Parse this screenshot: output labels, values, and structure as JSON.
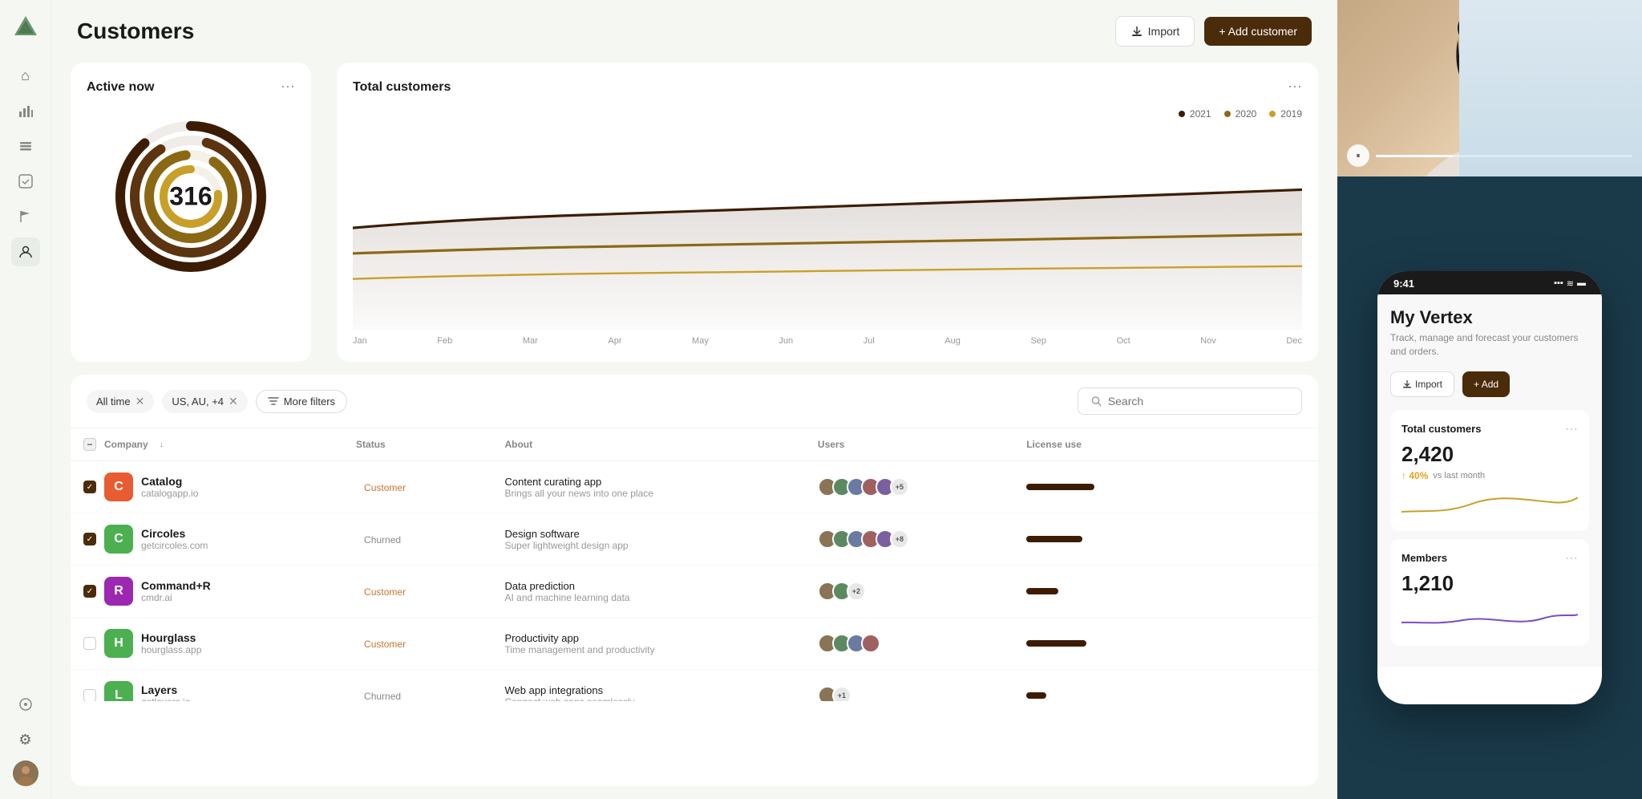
{
  "page": {
    "title": "Customers"
  },
  "header": {
    "import_label": "Import",
    "add_customer_label": "+ Add customer"
  },
  "sidebar": {
    "logo": "▲",
    "items": [
      {
        "icon": "⌂",
        "name": "home",
        "active": false
      },
      {
        "icon": "📊",
        "name": "analytics",
        "active": false
      },
      {
        "icon": "⊞",
        "name": "layers",
        "active": false
      },
      {
        "icon": "✓",
        "name": "tasks",
        "active": false
      },
      {
        "icon": "⚑",
        "name": "flags",
        "active": false
      },
      {
        "icon": "👥",
        "name": "customers",
        "active": true
      }
    ],
    "bottom_items": [
      {
        "icon": "⊙",
        "name": "profile"
      },
      {
        "icon": "⚙",
        "name": "settings"
      }
    ]
  },
  "active_now": {
    "title": "Active now",
    "value": "316",
    "rings": [
      {
        "color": "#3d1c04",
        "radius": 85,
        "dash": 220,
        "offset": 20
      },
      {
        "color": "#8B6914",
        "radius": 68,
        "dash": 180,
        "offset": 30
      },
      {
        "color": "#C8A028",
        "radius": 51,
        "dash": 160,
        "offset": 40
      },
      {
        "color": "#e8d0a0",
        "radius": 34,
        "dash": 120,
        "offset": 60
      }
    ]
  },
  "total_customers": {
    "title": "Total customers",
    "legend": [
      {
        "label": "2021",
        "color": "#3d1c04"
      },
      {
        "label": "2020",
        "color": "#8B6914"
      },
      {
        "label": "2019",
        "color": "#C8A028"
      }
    ],
    "months": [
      "Jan",
      "Feb",
      "Mar",
      "Apr",
      "May",
      "Jun",
      "Jul",
      "Aug",
      "Sep",
      "Oct",
      "Nov",
      "Dec"
    ]
  },
  "filters": {
    "all_time": "All time",
    "location": "US, AU, +4",
    "more_filters": "More filters",
    "search_placeholder": "Search"
  },
  "table": {
    "columns": {
      "company": "Company",
      "status": "Status",
      "about": "About",
      "users": "Users",
      "license_use": "License use"
    },
    "rows": [
      {
        "id": 1,
        "company": "Catalog",
        "url": "catalogapp.io",
        "color": "#e85c33",
        "logo_letter": "C",
        "status": "Customer",
        "status_type": "customer",
        "about_name": "Content curating app",
        "about_desc": "Brings all your news into one place",
        "users_count": "+5",
        "license_width": 85,
        "checked": true
      },
      {
        "id": 2,
        "company": "Circoles",
        "url": "getcircoles.com",
        "color": "#4caf50",
        "logo_letter": "C",
        "status": "Churned",
        "status_type": "churned",
        "about_name": "Design software",
        "about_desc": "Super lightweight design app",
        "users_count": "+8",
        "license_width": 70,
        "checked": true
      },
      {
        "id": 3,
        "company": "Command+R",
        "url": "cmdr.ai",
        "color": "#9c27b0",
        "logo_letter": "R",
        "status": "Customer",
        "status_type": "customer",
        "about_name": "Data prediction",
        "about_desc": "AI and machine learning data",
        "users_count": "+2",
        "license_width": 40,
        "checked": true
      },
      {
        "id": 4,
        "company": "Hourglass",
        "url": "hourglass.app",
        "color": "#4caf50",
        "logo_letter": "H",
        "status": "Customer",
        "status_type": "customer",
        "about_name": "Productivity app",
        "about_desc": "Time management and productivity",
        "users_count": "",
        "license_width": 75,
        "checked": false
      },
      {
        "id": 5,
        "company": "Layers",
        "url": "getlayers.io",
        "color": "#4caf50",
        "logo_letter": "L",
        "status": "Churned",
        "status_type": "churned",
        "about_name": "Web app integrations",
        "about_desc": "Connect web apps seamlessly",
        "users_count": "+1",
        "license_width": 25,
        "checked": false
      }
    ]
  },
  "phone": {
    "time": "9:41",
    "app_title": "My Vertex",
    "app_desc": "Track, manage and forecast your customers and orders.",
    "import_label": "Import",
    "add_label": "+ Add",
    "total_customers_label": "Total customers",
    "total_customers_value": "2,420",
    "growth_pct": "40%",
    "growth_label": "vs last month",
    "members_label": "Members",
    "members_value": "1,210"
  },
  "colors": {
    "primary_brown": "#4a2c0a",
    "dark_brown": "#3d1c04",
    "gold": "#8B6914",
    "light_gold": "#C8A028",
    "customer_orange": "#c87533",
    "churned_gray": "#888888"
  }
}
